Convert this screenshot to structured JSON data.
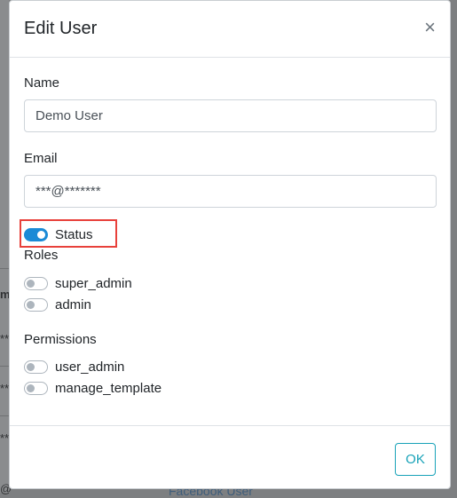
{
  "modal": {
    "title": "Edit User",
    "close_symbol": "×",
    "name": {
      "label": "Name",
      "value": "Demo User"
    },
    "email": {
      "label": "Email",
      "value": "***@*******"
    },
    "status": {
      "label": "Status",
      "on": true
    },
    "roles": {
      "label": "Roles",
      "items": [
        {
          "label": "super_admin",
          "on": false
        },
        {
          "label": "admin",
          "on": false
        }
      ]
    },
    "permissions": {
      "label": "Permissions",
      "items": [
        {
          "label": "user_admin",
          "on": false
        },
        {
          "label": "manage_template",
          "on": false
        }
      ]
    },
    "ok_label": "OK"
  },
  "background": {
    "row_marks": [
      "m",
      "**",
      "**",
      "**",
      "@"
    ],
    "footer_text": "Facebook User"
  },
  "colors": {
    "toggle_on": "#1a8ad6",
    "ok_button": "#17a2b8",
    "highlight": "#e8413b",
    "overlay": "#7d7f81"
  }
}
